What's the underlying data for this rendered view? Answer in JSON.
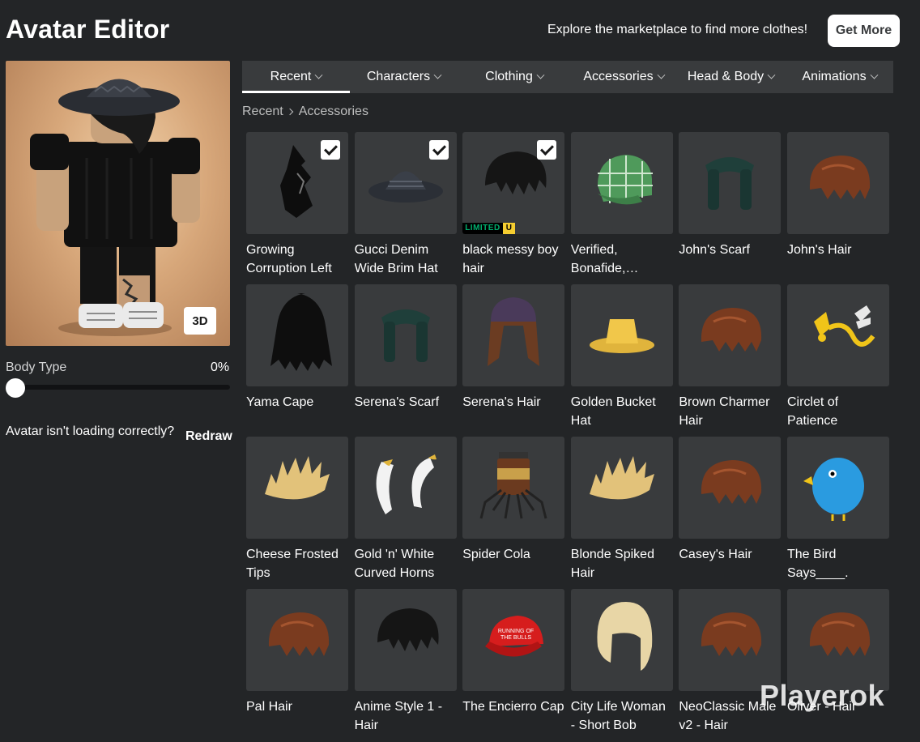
{
  "header": {
    "title": "Avatar Editor",
    "promo_text": "Explore the marketplace to find more clothes!",
    "get_more_label": "Get More"
  },
  "avatar": {
    "view_3d_label": "3D",
    "body_type_label": "Body Type",
    "body_type_value": "0%",
    "body_type_fraction": 0,
    "loading_question": "Avatar isn't loading correctly?",
    "redraw_label": "Redraw"
  },
  "tabs": [
    {
      "label": "Recent",
      "active": true
    },
    {
      "label": "Characters",
      "active": false
    },
    {
      "label": "Clothing",
      "active": false
    },
    {
      "label": "Accessories",
      "active": false
    },
    {
      "label": "Head & Body",
      "active": false
    },
    {
      "label": "Animations",
      "active": false
    }
  ],
  "breadcrumb": {
    "first": "Recent",
    "second": "Accessories"
  },
  "items": [
    {
      "name": "Growing Corruption Left",
      "selected": true,
      "icon": "dark-mask-icon"
    },
    {
      "name": "Gucci Denim Wide Brim Hat",
      "selected": true,
      "icon": "brim-hat-icon"
    },
    {
      "name": "black messy boy hair",
      "selected": true,
      "limited": true,
      "limited_label": "LIMITED",
      "limited_u": "U",
      "icon": "messy-hair-icon"
    },
    {
      "name": "Verified, Bonafide,…",
      "selected": false,
      "icon": "plaid-cap-icon"
    },
    {
      "name": "John's Scarf",
      "selected": false,
      "icon": "scarf-icon"
    },
    {
      "name": "John's Hair",
      "selected": false,
      "icon": "hair-icon"
    },
    {
      "name": "Yama Cape",
      "selected": false,
      "icon": "cape-icon"
    },
    {
      "name": "Serena's Scarf",
      "selected": false,
      "icon": "scarf-icon"
    },
    {
      "name": "Serena's Hair",
      "selected": false,
      "icon": "beanie-hair-icon"
    },
    {
      "name": "Golden Bucket Hat",
      "selected": false,
      "icon": "bucket-hat-icon"
    },
    {
      "name": "Brown Charmer Hair",
      "selected": false,
      "icon": "hair-icon"
    },
    {
      "name": "Circlet of Patience",
      "selected": false,
      "icon": "circlet-icon"
    },
    {
      "name": "Cheese Frosted Tips",
      "selected": false,
      "icon": "spiky-hair-icon"
    },
    {
      "name": "Gold 'n' White Curved Horns",
      "selected": false,
      "icon": "horns-icon"
    },
    {
      "name": "Spider Cola",
      "selected": false,
      "icon": "spider-cola-icon"
    },
    {
      "name": "Blonde Spiked Hair",
      "selected": false,
      "icon": "spiky-hair-icon"
    },
    {
      "name": "Casey's Hair",
      "selected": false,
      "icon": "hair-icon"
    },
    {
      "name": "The Bird Says____.",
      "selected": false,
      "icon": "bird-icon"
    },
    {
      "name": "Pal Hair",
      "selected": false,
      "icon": "hair-icon"
    },
    {
      "name": "Anime Style 1 - Hair",
      "selected": false,
      "icon": "messy-hair-icon"
    },
    {
      "name": "The Encierro Cap",
      "selected": false,
      "cap_text": "RUNNING OF THE BULLS",
      "icon": "red-cap-icon"
    },
    {
      "name": "City Life Woman - Short Bob",
      "selected": false,
      "icon": "bob-hair-icon"
    },
    {
      "name": "NeoClassic Male v2 - Hair",
      "selected": false,
      "icon": "hair-icon"
    },
    {
      "name": "Oliver - Hair",
      "selected": false,
      "icon": "hair-icon"
    }
  ],
  "watermark": "Playerok",
  "colors": {
    "background": "#232527",
    "tab_bar": "#393b3d",
    "card": "#393b3d",
    "limited_green": "#00b06f",
    "limited_yellow": "#f5cd30"
  }
}
